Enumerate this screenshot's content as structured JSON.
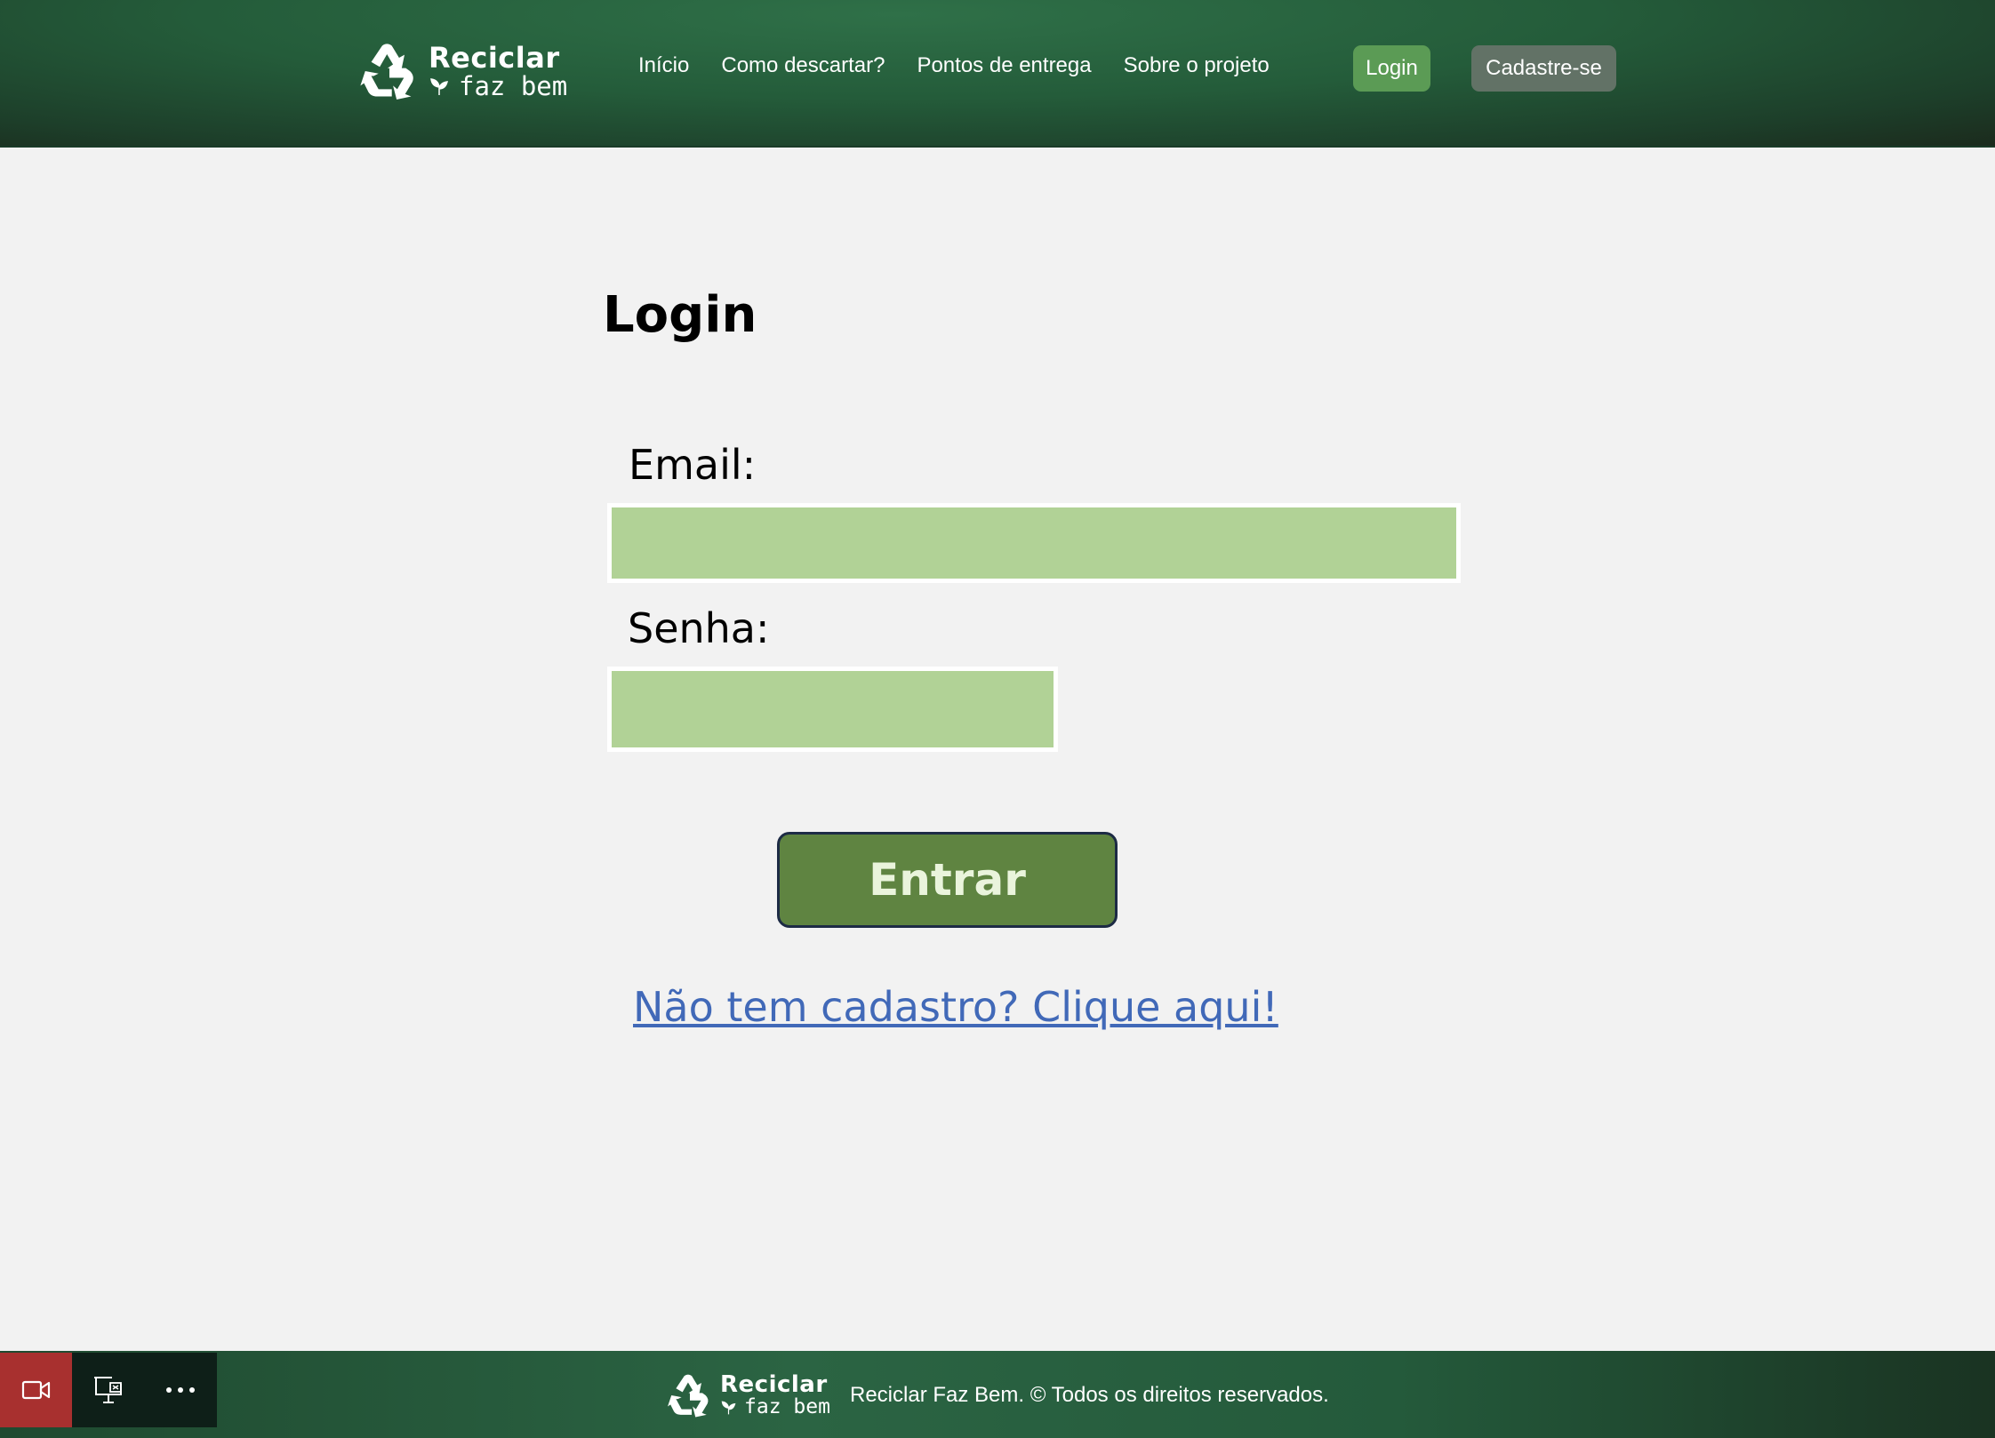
{
  "brand": {
    "name_line1": "Reciclar",
    "name_line2": "faz bem"
  },
  "nav": {
    "items": [
      {
        "label": "Início"
      },
      {
        "label": "Como descartar?"
      },
      {
        "label": "Pontos de entrega"
      },
      {
        "label": "Sobre o projeto"
      }
    ],
    "login_label": "Login",
    "signup_label": "Cadastre-se"
  },
  "form": {
    "title": "Login",
    "email_label": "Email:",
    "email_value": "",
    "password_label": "Senha:",
    "password_value": "",
    "submit_label": "Entrar",
    "signup_link": "Não tem cadastro? Clique aqui!"
  },
  "footer": {
    "copyright": "Reciclar Faz Bem. © Todos os direitos reservados."
  },
  "toolbar": {
    "icons": [
      "camera-icon",
      "screen-share-icon",
      "more-icon"
    ]
  },
  "colors": {
    "header_green": "#245c3a",
    "field_green": "#b1d296",
    "button_green": "#5f8441",
    "link_blue": "#4169b8",
    "login_btn": "#5b9b55",
    "signup_btn": "#627266"
  }
}
